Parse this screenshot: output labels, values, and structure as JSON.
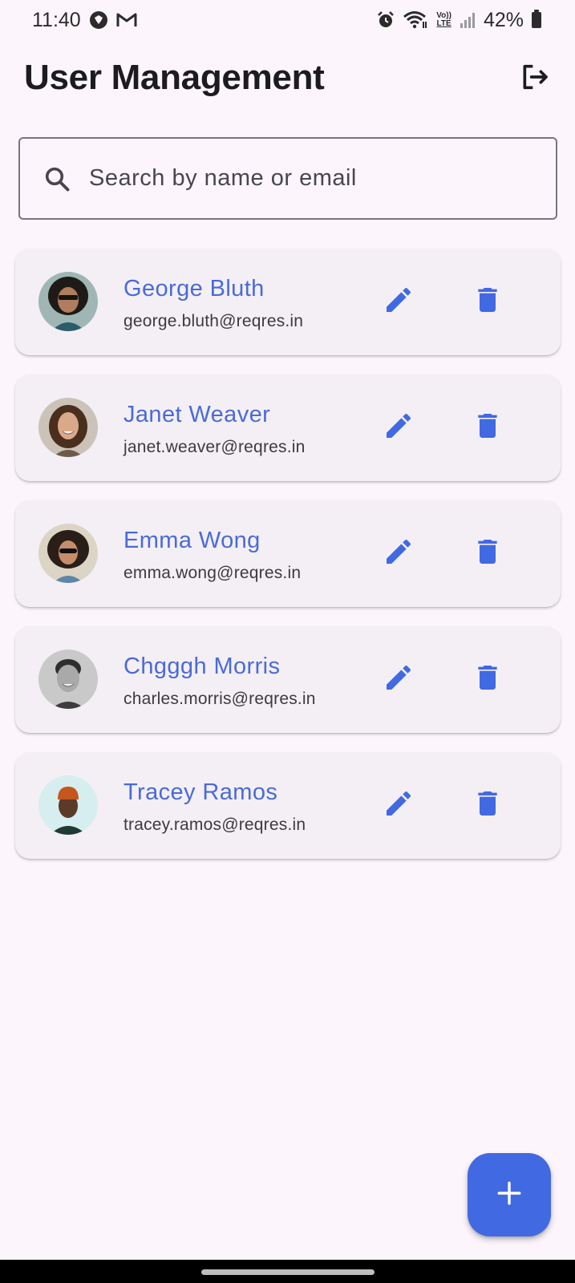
{
  "status_bar": {
    "time": "11:40",
    "battery": "42%",
    "left_icons": [
      "theme-store-icon",
      "gmail-icon"
    ],
    "right_icons": [
      "alarm-icon",
      "wifi-icon",
      "volte-icon",
      "signal-icon",
      "battery-icon"
    ],
    "volte_label_top": "Vo))",
    "volte_label_bottom": "LTE"
  },
  "app_bar": {
    "title": "User Management",
    "logout_icon": "logout-icon"
  },
  "search": {
    "placeholder": "Search by name or email",
    "value": ""
  },
  "users": [
    {
      "name": "George Bluth",
      "email": "george.bluth@reqres.in"
    },
    {
      "name": "Janet Weaver",
      "email": "janet.weaver@reqres.in"
    },
    {
      "name": "Emma Wong",
      "email": "emma.wong@reqres.in"
    },
    {
      "name": "Chgggh Morris",
      "email": "charles.morris@reqres.in"
    },
    {
      "name": "Tracey Ramos",
      "email": "tracey.ramos@reqres.in"
    }
  ],
  "fab": {
    "icon": "add-icon"
  },
  "colors": {
    "accent": "#4169e1",
    "name_text": "#4a6bd6",
    "background": "#fcf6fc",
    "card": "#f4eff5"
  }
}
